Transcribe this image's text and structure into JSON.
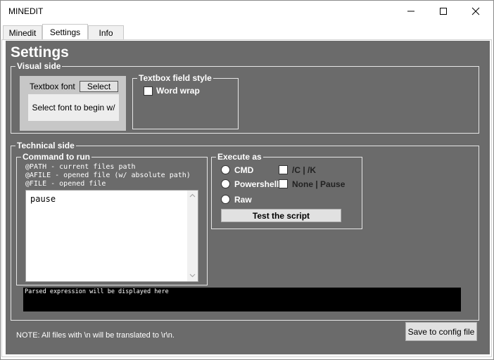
{
  "window": {
    "title": "MINEDIT"
  },
  "tabs": [
    {
      "label": "Minedit",
      "active": false
    },
    {
      "label": "Settings",
      "active": true
    },
    {
      "label": "Info",
      "active": false
    }
  ],
  "settings": {
    "heading": "Settings",
    "visual_side": {
      "label": "Visual side",
      "textbox_font_label": "Textbox font",
      "select_label": "Select",
      "font_preview": "Select font to begin w/"
    },
    "field_style": {
      "label": "Textbox field style",
      "word_wrap_label": "Word wrap",
      "word_wrap_checked": false
    },
    "technical_side": {
      "label": "Technical side",
      "command": {
        "label": "Command to run",
        "help_lines": [
          "@PATH - current files path",
          "@AFILE - opened file (w/ absolute path)",
          "@FILE - opened file"
        ],
        "value": "pause"
      },
      "execute_as": {
        "label": "Execute as",
        "options": [
          {
            "label": "CMD",
            "selected": false
          },
          {
            "label": "Powershell",
            "selected": false
          },
          {
            "label": "Raw",
            "selected": false
          }
        ],
        "flags": [
          {
            "label": "/C | /K",
            "checked": false
          },
          {
            "label": "None | Pause",
            "checked": false
          }
        ],
        "test_label": "Test the script"
      },
      "parsed_output": "Parsed expression will be displayed here"
    },
    "note": "NOTE: All files with \\n will be translated to \\r\\n.",
    "save_label": "Save to config file"
  },
  "colors": {
    "panel_bg": "#6b6b6b",
    "console_bg": "#000000",
    "text_light": "#ffffff"
  }
}
